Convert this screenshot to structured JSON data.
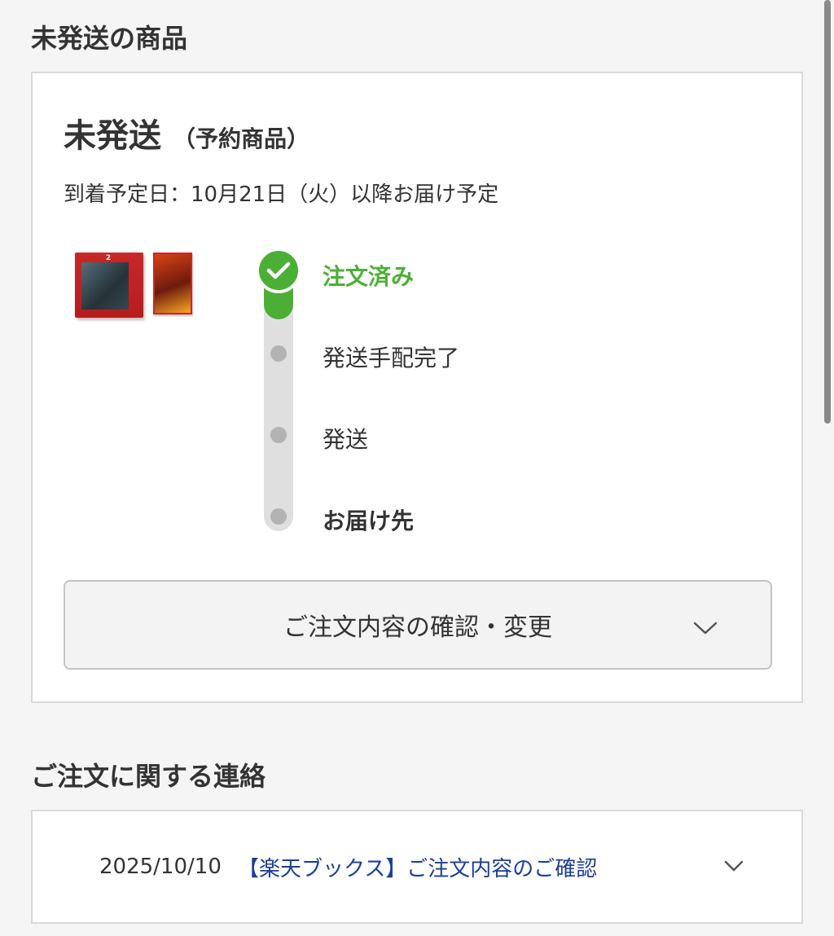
{
  "unshipped": {
    "section_title": "未発送の商品",
    "status": "未発送",
    "status_note": "（予約商品）",
    "arrival": "到着予定日：10月21日（火）以降お届け予定",
    "product_logo": "2",
    "steps": [
      {
        "label": "注文済み",
        "done": true
      },
      {
        "label": "発送手配完了",
        "done": false
      },
      {
        "label": "発送",
        "done": false
      },
      {
        "label": "お届け先",
        "done": false
      }
    ],
    "confirm_button": "ご注文内容の確認・変更"
  },
  "contact": {
    "section_title": "ご注文に関する連絡",
    "date": "2025/10/10",
    "subject": "【楽天ブックス】ご注文内容のご確認"
  },
  "colors": {
    "accent_green": "#4caf35",
    "link_blue": "#1a3d9c"
  },
  "icons": [
    "check-icon",
    "chevron-down-icon"
  ]
}
